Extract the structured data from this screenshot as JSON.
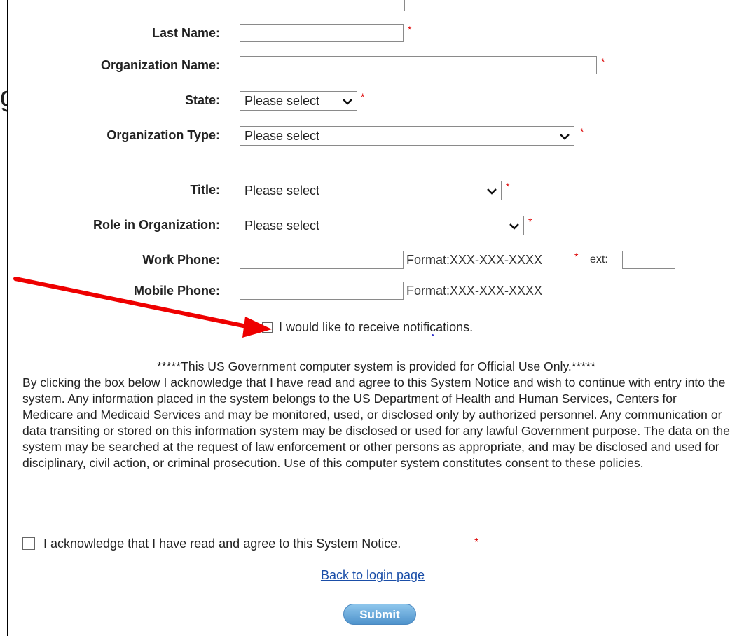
{
  "outside_text": "g",
  "fields": {
    "last_name": {
      "label": "Last Name:",
      "value": "",
      "req": "*"
    },
    "org_name": {
      "label": "Organization Name:",
      "value": "",
      "req": "*"
    },
    "state": {
      "label": "State:",
      "selected": "Please select",
      "req": "*"
    },
    "org_type": {
      "label": "Organization Type:",
      "selected": "Please select",
      "req": "*"
    },
    "title": {
      "label": "Title:",
      "selected": "Please select",
      "req": "*"
    },
    "role": {
      "label": "Role in Organization:",
      "selected": "Please select",
      "req": "*"
    },
    "work_phone": {
      "label": "Work Phone:",
      "value": "",
      "format": "Format:XXX-XXX-XXXX",
      "req": "*",
      "ext_label": "ext:",
      "ext_value": ""
    },
    "mobile_phone": {
      "label": "Mobile Phone:",
      "value": "",
      "format": "Format:XXX-XXX-XXXX"
    }
  },
  "notifications": {
    "label": "I would like to receive notifications.",
    "checked": false
  },
  "notice": {
    "heading": "*****This US Government computer system is provided for Official Use Only.*****",
    "body": "By clicking the box below I acknowledge that I have read and agree to this System Notice and wish to continue with entry into the system. Any information placed in the system belongs to the US Department of Health and Human Services, Centers for Medicare and Medicaid Services and may be monitored, used, or disclosed only by authorized personnel. Any communication or data transiting or stored on this information system may be disclosed or used for any lawful Government purpose. The data on the system may be searched at the request of law enforcement or other persons as appropriate, and may be disclosed and used for disciplinary, civil action, or criminal prosecution. Use of this computer system constitutes consent to these policies."
  },
  "acknowledge": {
    "label": "I acknowledge that I have read and agree to this System Notice.",
    "req": "*",
    "checked": false
  },
  "back_link": "Back to login page",
  "submit_label": "Submit",
  "colors": {
    "required": "#dd0000",
    "link": "#1a4ea8",
    "arrow": "#ee0000",
    "button": "#5a9fd4"
  },
  "icons": {
    "select_chevron": "chevron-down-icon",
    "annotation_arrow": "red-arrow-icon"
  }
}
